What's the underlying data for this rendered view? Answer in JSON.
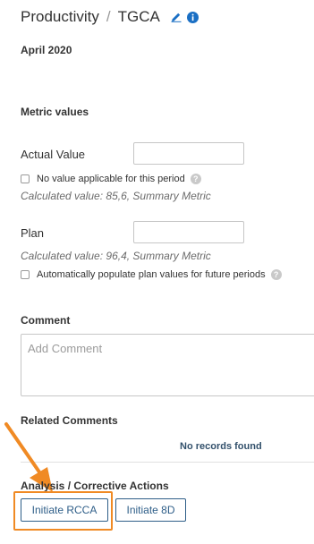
{
  "header": {
    "breadcrumb_parent": "Productivity",
    "separator": "/",
    "title": "TGCA",
    "edit_icon": "pencil-icon",
    "info_icon": "info-icon"
  },
  "period": "April 2020",
  "metric_values": {
    "heading": "Metric values",
    "actual": {
      "label": "Actual Value",
      "value": "",
      "no_value_label": "No value applicable for this period",
      "calculated": "Calculated value: 85,6, Summary Metric"
    },
    "plan": {
      "label": "Plan",
      "value": "",
      "calculated": "Calculated value: 96,4, Summary Metric",
      "auto_populate_label": "Automatically populate plan values for future periods"
    }
  },
  "comment": {
    "heading": "Comment",
    "placeholder": "Add Comment"
  },
  "related_comments": {
    "heading": "Related Comments",
    "empty_text": "No records found"
  },
  "actions": {
    "heading": "Analysis / Corrective Actions",
    "rcca_label": "Initiate RCCA",
    "eightd_label": "Initiate 8D"
  },
  "colors": {
    "accent": "#2e5e88",
    "highlight": "#f08a24",
    "icon_blue": "#1a6fc4"
  }
}
